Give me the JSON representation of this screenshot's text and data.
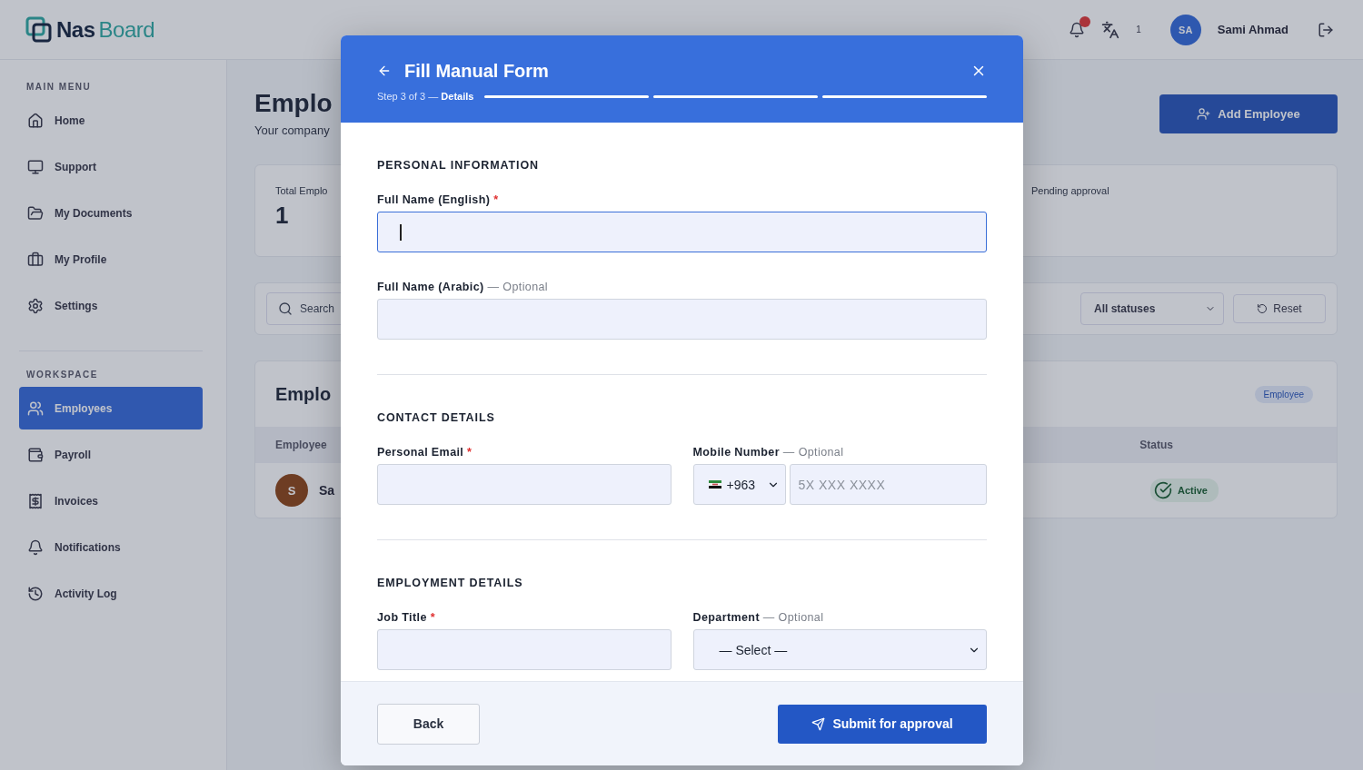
{
  "topbar": {
    "logo": {
      "first": "Nas",
      "second": "Board"
    },
    "notification_dot": true,
    "language_count": "1",
    "user": {
      "initials": "SA",
      "name": "Sami Ahmad"
    }
  },
  "sidebar": {
    "sections": [
      {
        "title": "MAIN MENU",
        "items": [
          {
            "label": "Home",
            "selected": false
          },
          {
            "label": "Support",
            "selected": false
          },
          {
            "label": "My Documents",
            "selected": false
          },
          {
            "label": "My Profile",
            "selected": false
          },
          {
            "label": "Settings",
            "selected": false
          }
        ]
      },
      {
        "title": "WORKSPACE",
        "items": [
          {
            "label": "Employees",
            "selected": true
          },
          {
            "label": "Payroll",
            "selected": false
          },
          {
            "label": "Invoices",
            "selected": false
          },
          {
            "label": "Notifications",
            "selected": false
          },
          {
            "label": "Activity Log",
            "selected": false
          }
        ]
      }
    ]
  },
  "page": {
    "title": "Emplo",
    "subtitle": "Your company",
    "add_button": "Add Employee",
    "stats": [
      {
        "label": "Total Emplo",
        "value": "1"
      },
      {
        "label": "Pending approval"
      }
    ],
    "search_placeholder": "Search",
    "status_filter": "All statuses",
    "reset_button": "Reset",
    "table": {
      "title": "Emplo",
      "badge": "Employee",
      "columns": [
        "Employee",
        "Status"
      ],
      "rows": [
        {
          "avatar": "S",
          "name": "Sa",
          "status": "Active"
        }
      ]
    }
  },
  "modal": {
    "title": "Fill Manual Form",
    "step_text": "Step 3 of 3 — ",
    "step_name": "Details",
    "steps": [
      {
        "done": true
      },
      {
        "done": true
      },
      {
        "done": true
      }
    ],
    "sections": [
      {
        "title": "PERSONAL INFORMATION",
        "rows": [
          [
            {
              "kind": "text",
              "label": "Full Name (English)",
              "marker": "*",
              "focused": true
            }
          ],
          [
            {
              "kind": "text",
              "label": "Full Name (Arabic)",
              "note": "— Optional",
              "focused": false
            }
          ]
        ]
      },
      {
        "title": "CONTACT DETAILS",
        "rows": [
          [
            {
              "kind": "text",
              "label": "Personal Email",
              "marker": "*",
              "focused": false
            },
            {
              "kind": "phone",
              "label": "Mobile Number",
              "note": "— Optional",
              "code": "+963",
              "placeholder": "5X XXX XXXX",
              "focused": false
            }
          ]
        ]
      },
      {
        "title": "EMPLOYMENT DETAILS",
        "rows": [
          [
            {
              "kind": "text",
              "label": "Job Title",
              "marker": "*",
              "focused": false
            },
            {
              "kind": "select",
              "label": "Department",
              "note": "— Optional",
              "value": "— Select —",
              "focused": false
            }
          ]
        ]
      }
    ],
    "back_button": "Back",
    "submit_button": "Submit for approval"
  }
}
